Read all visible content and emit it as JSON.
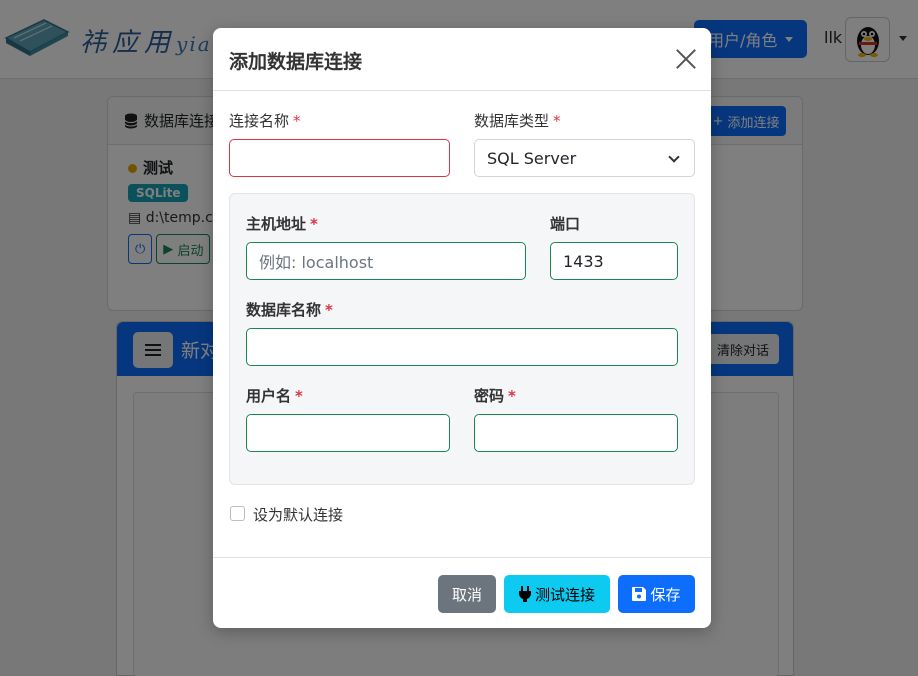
{
  "app": {
    "logo_text": "祎应用",
    "logo_pinyin": "yia",
    "role_menu_label": "用户/角色",
    "username": "llk"
  },
  "background": {
    "db_card_title": "数据库连接",
    "add_connection_label": "添加连接",
    "connection": {
      "name": "测试",
      "type_badge": "SQLite",
      "path": "d:\\temp.c",
      "start_label": "启动"
    },
    "chat_title": "新对",
    "clear_chat_label": "清除对话"
  },
  "modal": {
    "title": "添加数据库连接",
    "fields": {
      "connection_name": {
        "label": "连接名称",
        "required": "*",
        "value": ""
      },
      "db_type": {
        "label": "数据库类型",
        "required": "*",
        "value": "SQL Server"
      },
      "host": {
        "label": "主机地址",
        "required": "*",
        "placeholder": "例如: localhost",
        "value": ""
      },
      "port": {
        "label": "端口",
        "value": "1433"
      },
      "database_name": {
        "label": "数据库名称",
        "required": "*",
        "value": ""
      },
      "username": {
        "label": "用户名",
        "required": "*",
        "value": ""
      },
      "password": {
        "label": "密码",
        "required": "*",
        "value": ""
      }
    },
    "default_checkbox_label": "设为默认连接",
    "buttons": {
      "cancel": "取消",
      "test": "测试连接",
      "save": "保存"
    }
  },
  "colors": {
    "primary": "#0d6efd",
    "info": "#0dcaf0",
    "secondary": "#6c757d",
    "valid_border": "#198754",
    "invalid_border": "#dc3545"
  }
}
